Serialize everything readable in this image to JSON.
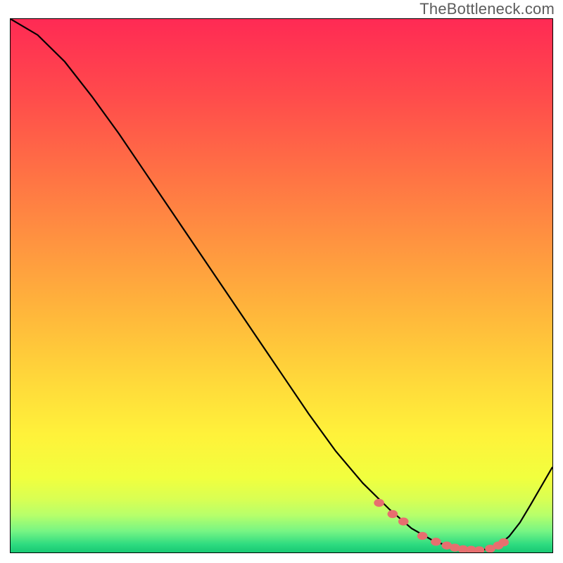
{
  "watermark": "TheBottleneck.com",
  "chart_data": {
    "type": "line",
    "title": "",
    "xlabel": "",
    "ylabel": "",
    "xlim": [
      0,
      100
    ],
    "ylim": [
      0,
      100
    ],
    "curve": {
      "x": [
        0,
        5,
        10,
        15,
        20,
        25,
        30,
        35,
        40,
        45,
        50,
        55,
        60,
        65,
        70,
        74,
        78,
        81,
        84,
        87,
        90,
        92,
        94,
        96,
        98,
        100
      ],
      "y": [
        100,
        97,
        92,
        85.5,
        78.5,
        71,
        63.5,
        56,
        48.5,
        41,
        33.5,
        26,
        19,
        13,
        8,
        4.5,
        2.2,
        1.1,
        0.5,
        0.4,
        1.3,
        3.0,
        5.6,
        9.0,
        12.5,
        16.0
      ]
    },
    "markers": {
      "x": [
        68,
        70.5,
        72.5,
        76,
        78.5,
        80.5,
        82,
        83.5,
        85,
        86.5,
        88.5,
        90,
        91
      ],
      "y": [
        9.3,
        7.2,
        5.8,
        3.1,
        2.0,
        1.3,
        0.9,
        0.6,
        0.5,
        0.4,
        0.7,
        1.3,
        1.9
      ]
    },
    "marker_color": "#e76f6f",
    "gradient_stops": [
      {
        "offset": 0.0,
        "color": "#ff2a54"
      },
      {
        "offset": 0.14,
        "color": "#ff4a4c"
      },
      {
        "offset": 0.28,
        "color": "#ff6f45"
      },
      {
        "offset": 0.42,
        "color": "#ff9440"
      },
      {
        "offset": 0.56,
        "color": "#ffb93b"
      },
      {
        "offset": 0.68,
        "color": "#ffd93a"
      },
      {
        "offset": 0.78,
        "color": "#fff23a"
      },
      {
        "offset": 0.86,
        "color": "#f1ff3e"
      },
      {
        "offset": 0.9,
        "color": "#d9ff53"
      },
      {
        "offset": 0.93,
        "color": "#b7ff6a"
      },
      {
        "offset": 0.96,
        "color": "#77f584"
      },
      {
        "offset": 0.985,
        "color": "#2edb80"
      },
      {
        "offset": 1.0,
        "color": "#18c873"
      }
    ]
  }
}
